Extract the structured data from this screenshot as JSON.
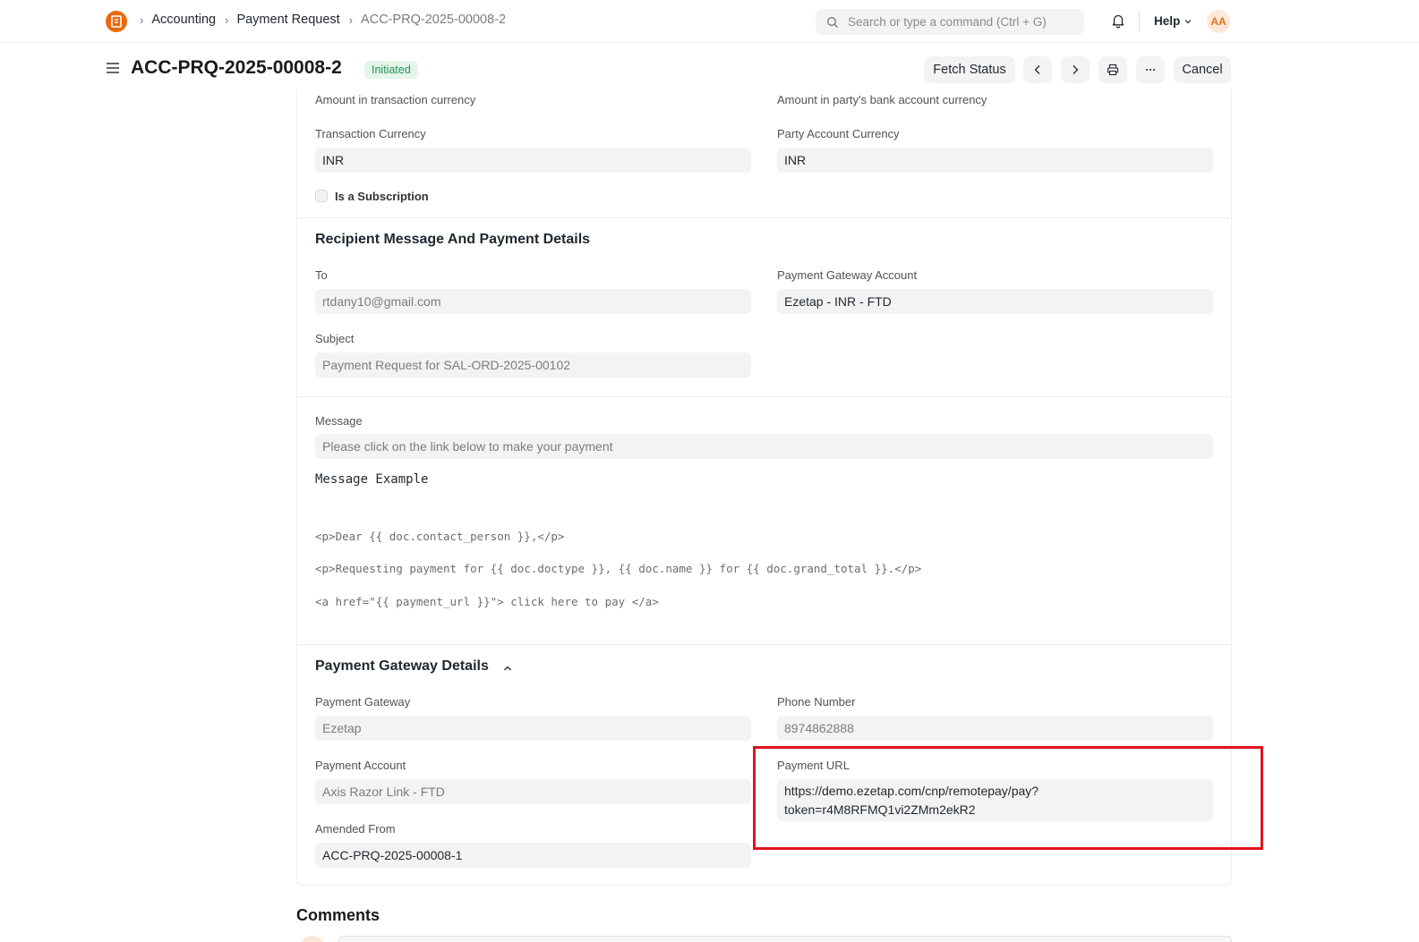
{
  "navbar": {
    "logo_text": "ERP",
    "breadcrumbs": [
      "Accounting",
      "Payment Request",
      "ACC-PRQ-2025-00008-2"
    ],
    "search_placeholder": "Search or type a command (Ctrl + G)",
    "help_label": "Help",
    "avatar_initials": "AA"
  },
  "header": {
    "title": "ACC-PRQ-2025-00008-2",
    "status": "Initiated",
    "fetch_status_label": "Fetch Status",
    "cancel_label": "Cancel"
  },
  "form": {
    "amount_in_txn_currency_label": "Amount in transaction currency",
    "amount_in_party_currency_label": "Amount in party's bank account currency",
    "transaction_currency_label": "Transaction Currency",
    "transaction_currency_value": "INR",
    "party_account_currency_label": "Party Account Currency",
    "party_account_currency_value": "INR",
    "is_subscription_label": "Is a Subscription",
    "recipient_section_title": "Recipient Message And Payment Details",
    "to_label": "To",
    "to_value": "rtdany10@gmail.com",
    "gateway_account_label": "Payment Gateway Account",
    "gateway_account_value": "Ezetap - INR - FTD",
    "subject_label": "Subject",
    "subject_value": "Payment Request for SAL-ORD-2025-00102",
    "message_label": "Message",
    "message_value": "Please click on the link below to make your payment",
    "message_example_title": "Message Example",
    "message_example_lines": [
      "<p>Dear {{ doc.contact_person }},</p>",
      "<p>Requesting payment for {{ doc.doctype }}, {{ doc.name }} for {{ doc.grand_total }}.</p>",
      "<a href=\"{{ payment_url }}\"> click here to pay </a>"
    ],
    "gateway_section_title": "Payment Gateway Details",
    "payment_gateway_label": "Payment Gateway",
    "payment_gateway_value": "Ezetap",
    "phone_number_label": "Phone Number",
    "phone_number_value": "8974862888",
    "payment_account_label": "Payment Account",
    "payment_account_value": "Axis Razor Link - FTD",
    "payment_url_label": "Payment URL",
    "payment_url_value": "https://demo.ezetap.com/cnp/remotepay/pay?token=r4M8RFMQ1vi2ZMm2ekR2",
    "amended_from_label": "Amended From",
    "amended_from_value": "ACC-PRQ-2025-00008-1"
  },
  "comments": {
    "title": "Comments"
  },
  "colors": {
    "brand": "#ea6a10",
    "status_bg": "#e4f5e9",
    "status_text": "#278f5e",
    "highlight": "#e0131f"
  }
}
